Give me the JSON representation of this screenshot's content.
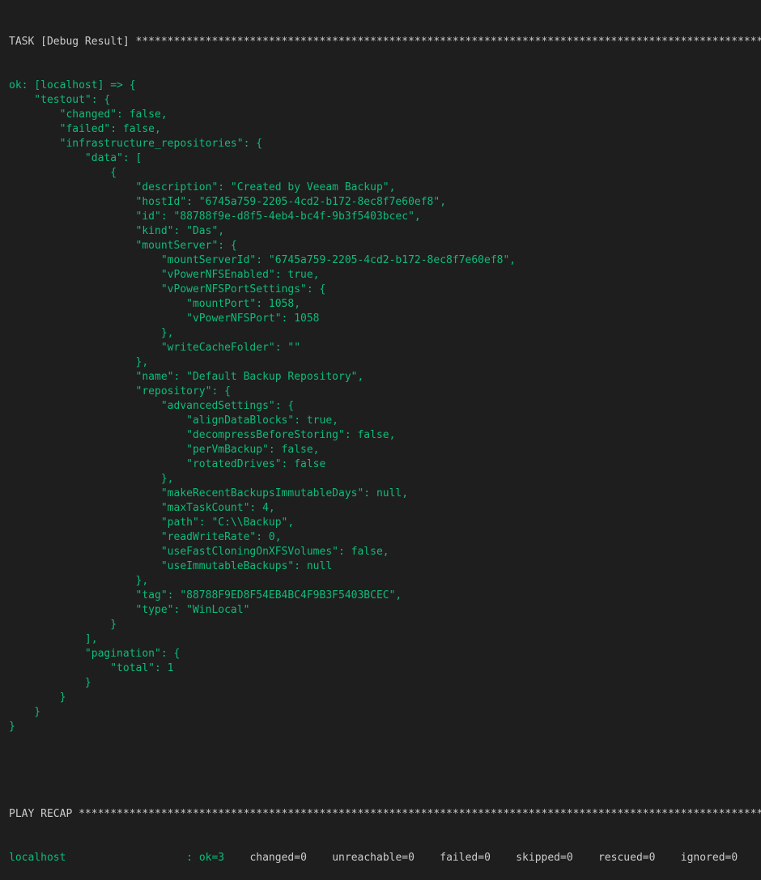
{
  "task_header": "TASK [Debug Result] ***************************************************************************************************************",
  "output_lines": [
    "ok: [localhost] => {",
    "    \"testout\": {",
    "        \"changed\": false,",
    "        \"failed\": false,",
    "        \"infrastructure_repositories\": {",
    "            \"data\": [",
    "                {",
    "                    \"description\": \"Created by Veeam Backup\",",
    "                    \"hostId\": \"6745a759-2205-4cd2-b172-8ec8f7e60ef8\",",
    "                    \"id\": \"88788f9e-d8f5-4eb4-bc4f-9b3f5403bcec\",",
    "                    \"kind\": \"Das\",",
    "                    \"mountServer\": {",
    "                        \"mountServerId\": \"6745a759-2205-4cd2-b172-8ec8f7e60ef8\",",
    "                        \"vPowerNFSEnabled\": true,",
    "                        \"vPowerNFSPortSettings\": {",
    "                            \"mountPort\": 1058,",
    "                            \"vPowerNFSPort\": 1058",
    "                        },",
    "                        \"writeCacheFolder\": \"\"",
    "                    },",
    "                    \"name\": \"Default Backup Repository\",",
    "                    \"repository\": {",
    "                        \"advancedSettings\": {",
    "                            \"alignDataBlocks\": true,",
    "                            \"decompressBeforeStoring\": false,",
    "                            \"perVmBackup\": false,",
    "                            \"rotatedDrives\": false",
    "                        },",
    "                        \"makeRecentBackupsImmutableDays\": null,",
    "                        \"maxTaskCount\": 4,",
    "                        \"path\": \"C:\\\\Backup\",",
    "                        \"readWriteRate\": 0,",
    "                        \"useFastCloningOnXFSVolumes\": false,",
    "                        \"useImmutableBackups\": null",
    "                    },",
    "                    \"tag\": \"88788F9ED8F54EB4BC4F9B3F5403BCEC\",",
    "                    \"type\": \"WinLocal\"",
    "                }",
    "            ],",
    "            \"pagination\": {",
    "                \"total\": 1",
    "            }",
    "        }",
    "    }",
    "}"
  ],
  "recap_header": "PLAY RECAP ********************************************************************************************************************",
  "recap": {
    "host": "localhost",
    "ok": ": ok=3",
    "changed": "changed=0",
    "unreachable": "unreachable=0",
    "failed": "failed=0",
    "skipped": "skipped=0",
    "rescued": "rescued=0",
    "ignored": "ignored=0"
  },
  "colors": {
    "background": "#1e1e1e",
    "text": "#cccccc",
    "ok_green": "#0dbc79"
  }
}
